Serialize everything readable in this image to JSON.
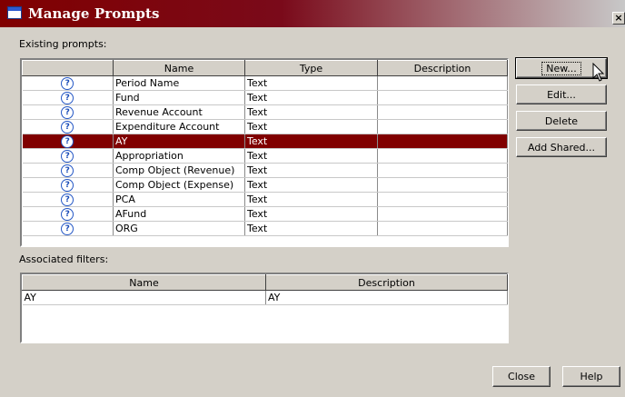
{
  "window": {
    "title": "Manage Prompts",
    "close_label": "×"
  },
  "existing": {
    "label": "Existing prompts:",
    "headers": {
      "icon": "",
      "name": "Name",
      "type": "Type",
      "description": "Description"
    },
    "rows": [
      {
        "name": "Period Name",
        "type": "Text",
        "description": ""
      },
      {
        "name": "Fund",
        "type": "Text",
        "description": ""
      },
      {
        "name": "Revenue Account",
        "type": "Text",
        "description": ""
      },
      {
        "name": "Expenditure Account",
        "type": "Text",
        "description": ""
      },
      {
        "name": "AY",
        "type": "Text",
        "description": "",
        "selected": true
      },
      {
        "name": "Appropriation",
        "type": "Text",
        "description": ""
      },
      {
        "name": "Comp Object (Revenue)",
        "type": "Text",
        "description": ""
      },
      {
        "name": "Comp Object (Expense)",
        "type": "Text",
        "description": ""
      },
      {
        "name": "PCA",
        "type": "Text",
        "description": ""
      },
      {
        "name": "AFund",
        "type": "Text",
        "description": ""
      },
      {
        "name": "ORG",
        "type": "Text",
        "description": ""
      }
    ],
    "icon_glyph": "?"
  },
  "buttons": {
    "new": "New...",
    "edit": "Edit...",
    "delete": "Delete",
    "add_shared": "Add Shared...",
    "close": "Close",
    "help": "Help"
  },
  "filters": {
    "label": "Associated filters:",
    "headers": {
      "name": "Name",
      "description": "Description"
    },
    "rows": [
      {
        "name": "AY",
        "description": "AY"
      }
    ]
  },
  "colors": {
    "selection": "#800000",
    "title_bar": "#800000",
    "dialog_bg": "#d4d0c8"
  }
}
